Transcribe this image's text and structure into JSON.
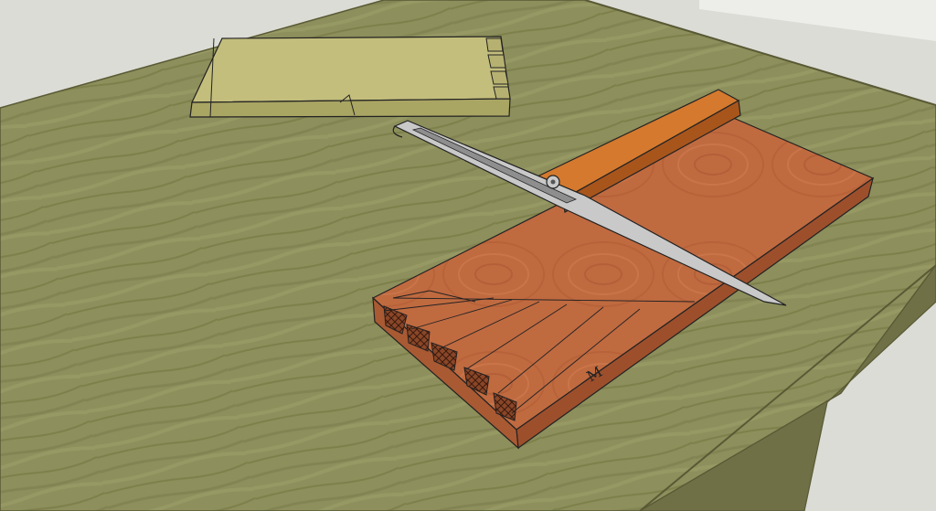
{
  "scene": {
    "kind": "3d-woodworking-render",
    "objects": [
      "floor-backdrop",
      "workbench-top",
      "tail-board-dovetails",
      "pin-board-layout",
      "sliding-bevel-gauge"
    ],
    "colors": {
      "floor": "#dcdcd6",
      "bench_top": "#8d8f5c",
      "bench_edge": "#6f7046",
      "bench_line": "#595a35",
      "tail_board": "#c3be7c",
      "tail_board_end": "#a9a563",
      "pin_board": "#c06a40",
      "pin_board_edge": "#9d4f2c",
      "end_grain": "#7a3e22",
      "bevel_stock": "#d4792e",
      "bevel_stock_dark": "#a8551c",
      "bevel_blade": "#c9c9c9",
      "bevel_blade_dark": "#8e8e8e",
      "outline": "#222222"
    },
    "marks": {
      "pin_board_letter": "M"
    }
  }
}
